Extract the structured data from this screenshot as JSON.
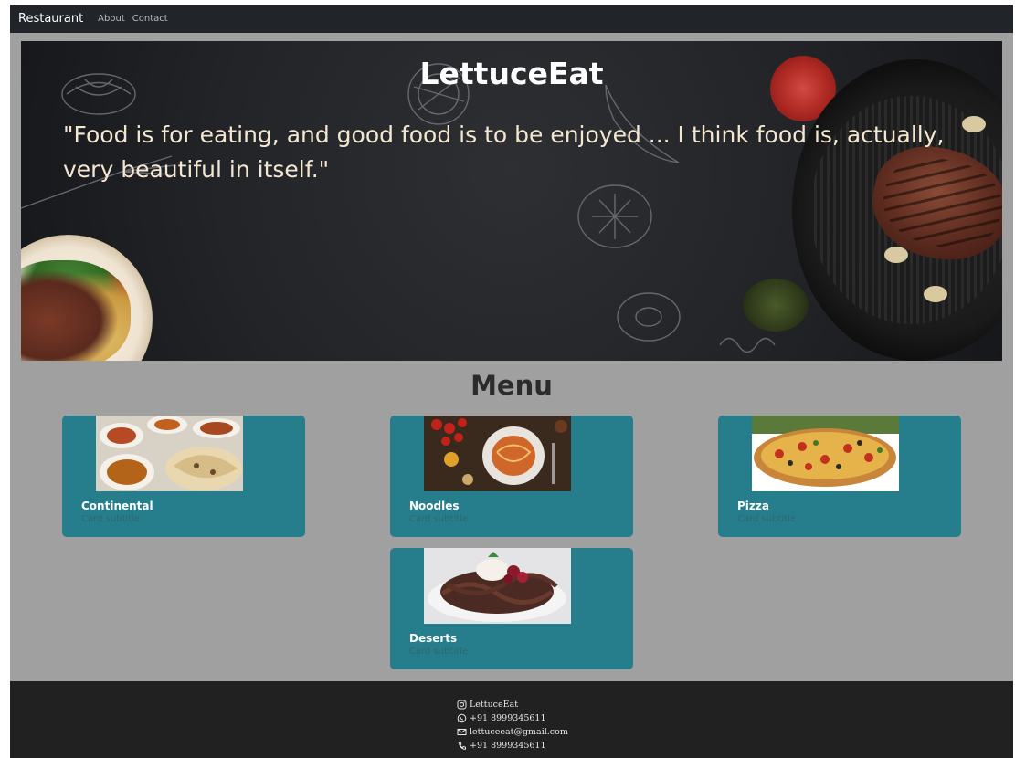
{
  "navbar": {
    "brand": "Restaurant",
    "links": [
      "About",
      "Contact"
    ]
  },
  "hero": {
    "title": "LettuceEat",
    "quote": "\"Food is for eating, and good food is to be enjoyed ... I think food is, actually, very beautiful in itself.\""
  },
  "menu": {
    "title": "Menu",
    "cards": [
      {
        "title": "Continental",
        "subtitle": "Card subtitle"
      },
      {
        "title": "Noodles",
        "subtitle": "Card subtitle"
      },
      {
        "title": "Pizza",
        "subtitle": "Card subtitle"
      },
      {
        "title": "Deserts",
        "subtitle": "Card subtitle"
      }
    ]
  },
  "footer": {
    "instagram": "LettuceEat",
    "whatsapp": "+91 8999345611",
    "email": "lettuceeat@gmail.com",
    "phone": "+91 8999345611"
  },
  "icons": [
    "instagram-icon",
    "whatsapp-icon",
    "email-icon",
    "phone-icon"
  ],
  "colors": {
    "navbar": "#212529",
    "page_background": "#a0a0a0",
    "card": "#267e8d",
    "footer": "#212121"
  }
}
